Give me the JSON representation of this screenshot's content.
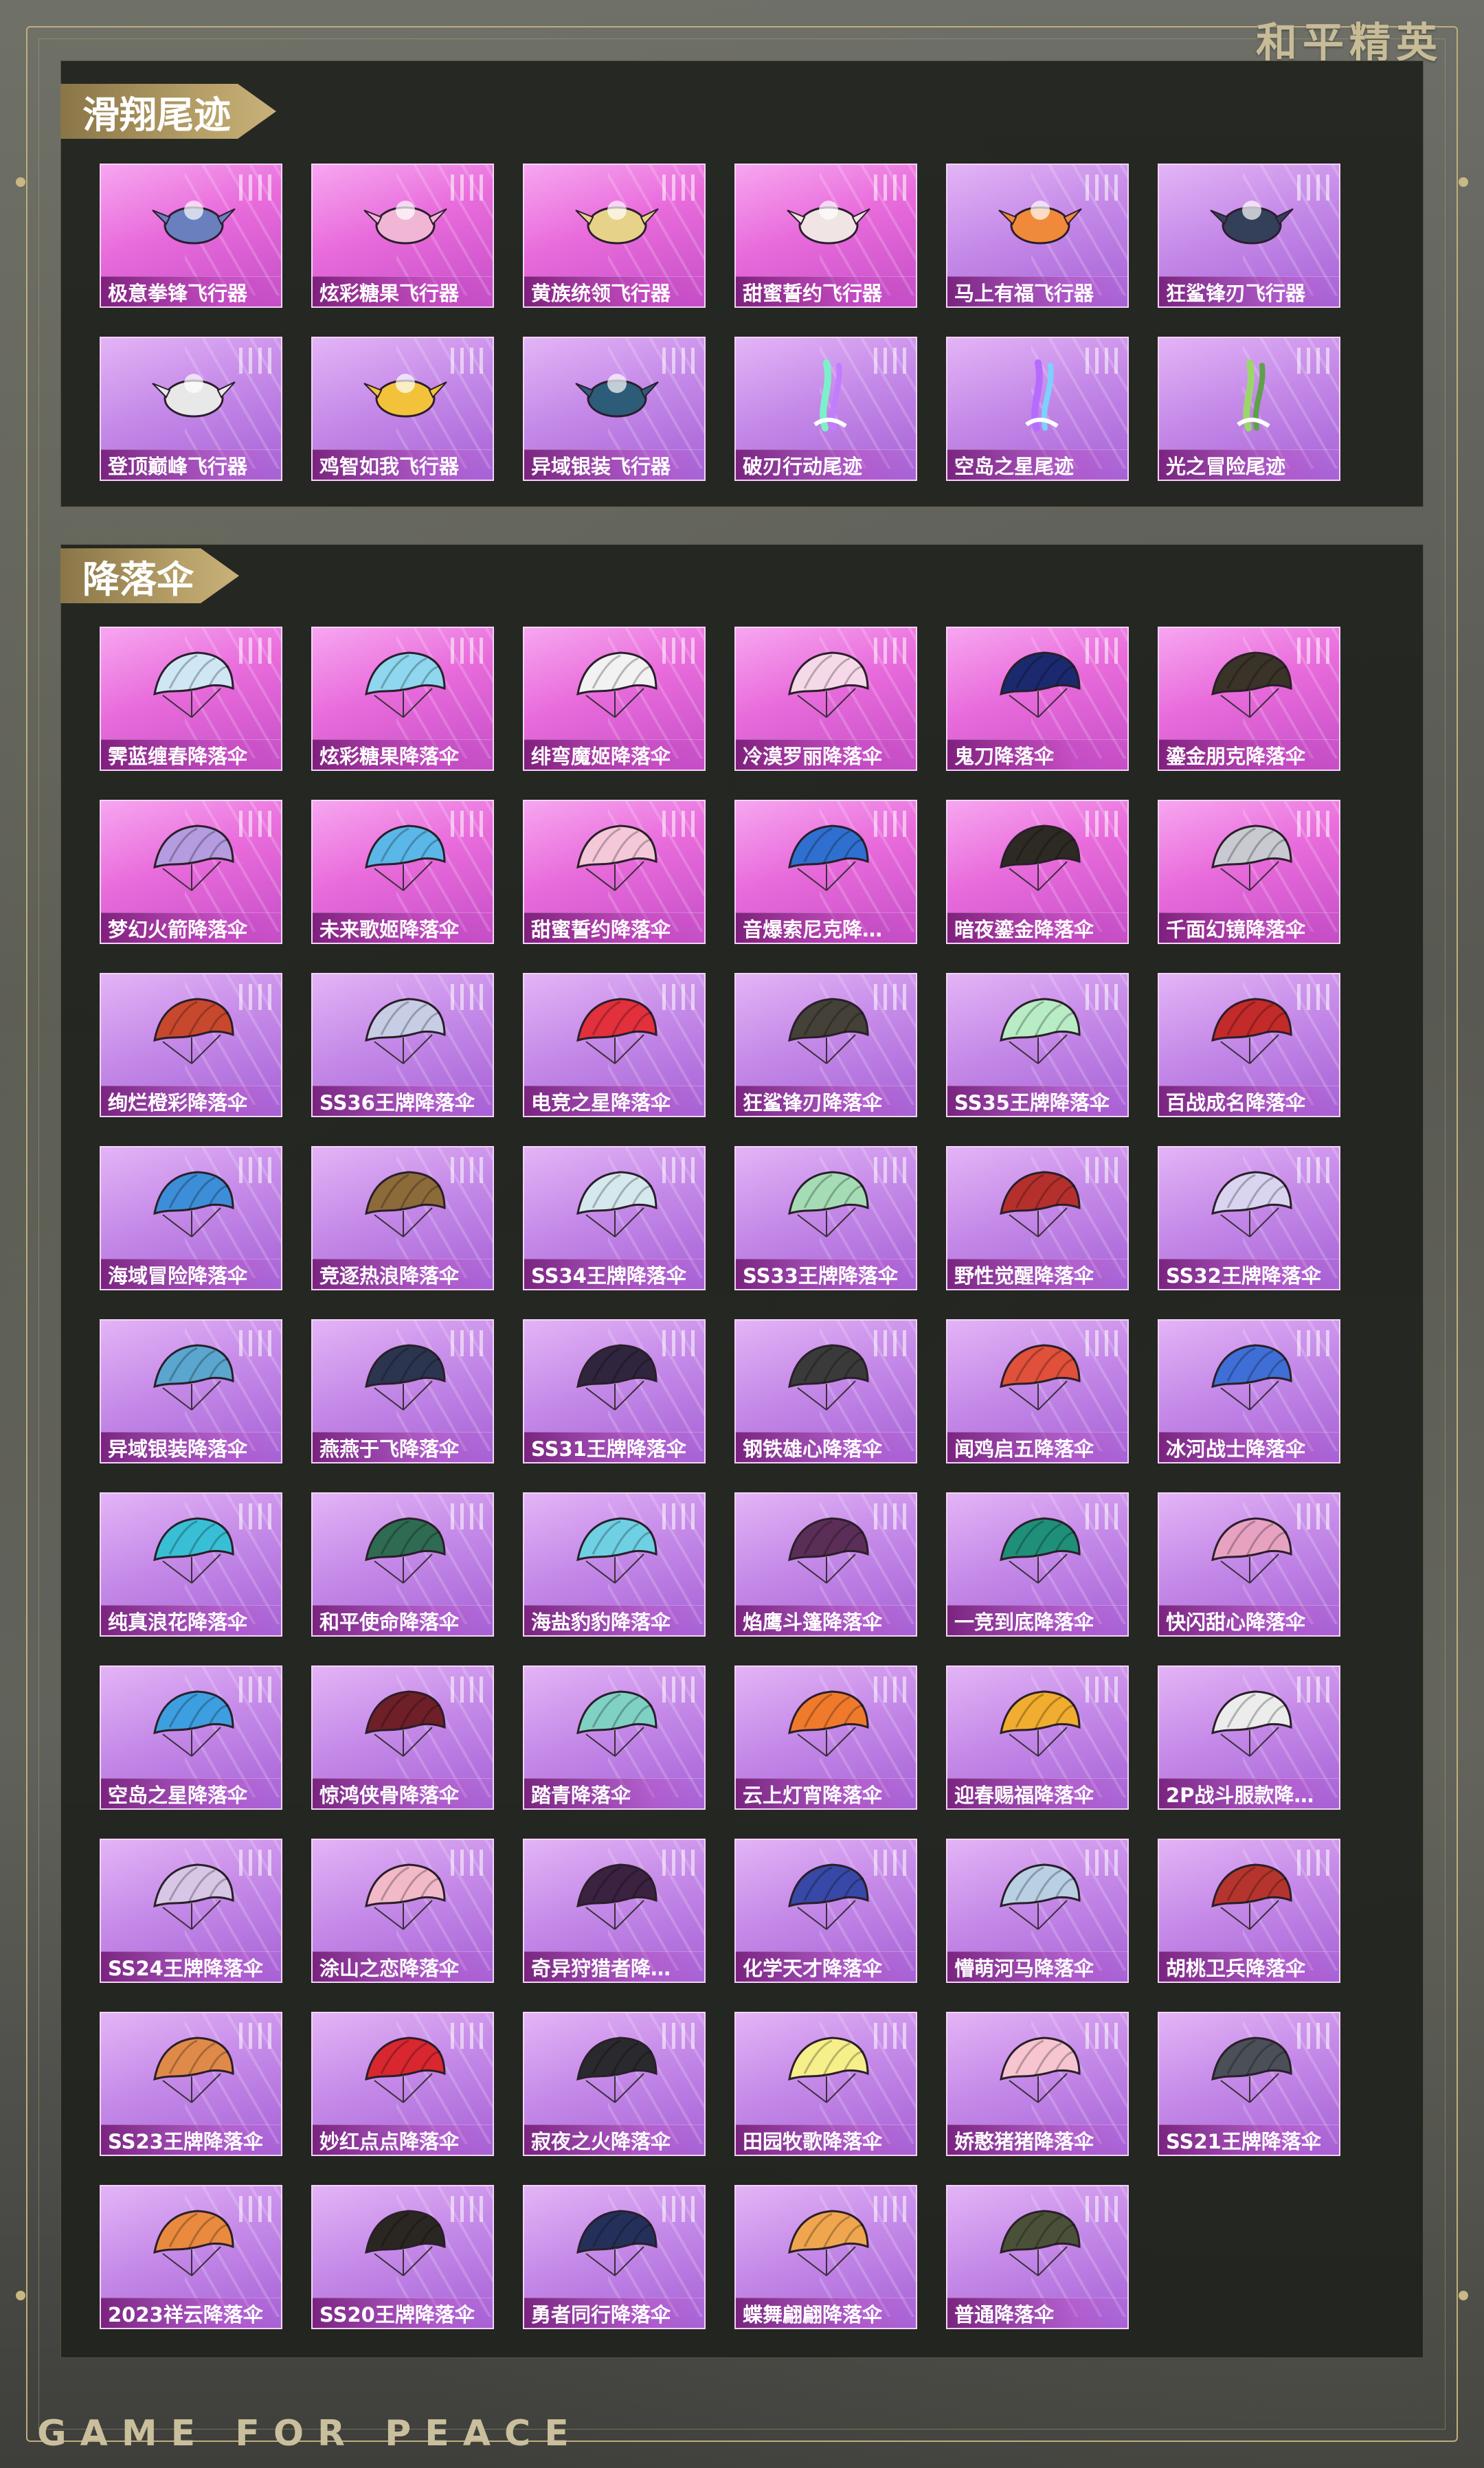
{
  "brand": {
    "logo": "和平精英",
    "footer": "GAME FOR PEACE"
  },
  "sections": [
    {
      "title": "滑翔尾迹",
      "items": [
        {
          "name": "极意拳锋飞行器",
          "type": "glider",
          "bg": "pink"
        },
        {
          "name": "炫彩糖果飞行器",
          "type": "glider",
          "bg": "pink"
        },
        {
          "name": "黄族统领飞行器",
          "type": "glider",
          "bg": "pink"
        },
        {
          "name": "甜蜜誓约飞行器",
          "type": "glider",
          "bg": "pink"
        },
        {
          "name": "马上有福飞行器",
          "type": "glider",
          "bg": "purple"
        },
        {
          "name": "狂鲨锋刃飞行器",
          "type": "glider",
          "bg": "purple"
        },
        {
          "name": "登顶巅峰飞行器",
          "type": "glider",
          "bg": "purple"
        },
        {
          "name": "鸡智如我飞行器",
          "type": "glider",
          "bg": "purple"
        },
        {
          "name": "异域银装飞行器",
          "type": "glider",
          "bg": "purple"
        },
        {
          "name": "破刃行动尾迹",
          "type": "trail",
          "bg": "purple"
        },
        {
          "name": "空岛之星尾迹",
          "type": "trail",
          "bg": "purple"
        },
        {
          "name": "光之冒险尾迹",
          "type": "trail",
          "bg": "purple"
        }
      ]
    },
    {
      "title": "降落伞",
      "items": [
        {
          "name": "霁蓝缠春降落伞",
          "type": "parachute",
          "bg": "pink",
          "color": "#cfe6f5"
        },
        {
          "name": "炫彩糖果降落伞",
          "type": "parachute",
          "bg": "pink",
          "color": "#8fd6ef"
        },
        {
          "name": "绯弯魔姬降落伞",
          "type": "parachute",
          "bg": "pink",
          "color": "#f2f2f2"
        },
        {
          "name": "冷漠罗丽降落伞",
          "type": "parachute",
          "bg": "pink",
          "color": "#f6d9e8"
        },
        {
          "name": "鬼刀降落伞",
          "type": "parachute",
          "bg": "pink",
          "color": "#1b2a6e"
        },
        {
          "name": "鎏金朋克降落伞",
          "type": "parachute",
          "bg": "pink",
          "color": "#3a3328"
        },
        {
          "name": "梦幻火箭降落伞",
          "type": "parachute",
          "bg": "pink",
          "color": "#b59be0"
        },
        {
          "name": "未来歌姬降落伞",
          "type": "parachute",
          "bg": "pink",
          "color": "#5ab7e8"
        },
        {
          "name": "甜蜜誓约降落伞",
          "type": "parachute",
          "bg": "pink",
          "color": "#f4c8d8"
        },
        {
          "name": "音爆索尼克降…",
          "type": "parachute",
          "bg": "pink",
          "color": "#2f6fd0"
        },
        {
          "name": "暗夜鎏金降落伞",
          "type": "parachute",
          "bg": "pink",
          "color": "#2d2a24"
        },
        {
          "name": "千面幻镜降落伞",
          "type": "parachute",
          "bg": "pink",
          "color": "#c9c9d2"
        },
        {
          "name": "绚烂橙彩降落伞",
          "type": "parachute",
          "bg": "purple",
          "color": "#c8482e"
        },
        {
          "name": "SS36王牌降落伞",
          "type": "parachute",
          "bg": "purple",
          "color": "#c7cde4"
        },
        {
          "name": "电竞之星降落伞",
          "type": "parachute",
          "bg": "purple",
          "color": "#e2303c"
        },
        {
          "name": "狂鲨锋刃降落伞",
          "type": "parachute",
          "bg": "purple",
          "color": "#444139"
        },
        {
          "name": "SS35王牌降落伞",
          "type": "parachute",
          "bg": "purple",
          "color": "#b8ecc4"
        },
        {
          "name": "百战成名降落伞",
          "type": "parachute",
          "bg": "purple",
          "color": "#c32a2a"
        },
        {
          "name": "海域冒险降落伞",
          "type": "parachute",
          "bg": "purple",
          "color": "#3d8ed8"
        },
        {
          "name": "竞逐热浪降落伞",
          "type": "parachute",
          "bg": "purple",
          "color": "#8c6a3a"
        },
        {
          "name": "SS34王牌降落伞",
          "type": "parachute",
          "bg": "purple",
          "color": "#d5e8ee"
        },
        {
          "name": "SS33王牌降落伞",
          "type": "parachute",
          "bg": "purple",
          "color": "#a5dcb6"
        },
        {
          "name": "野性觉醒降落伞",
          "type": "parachute",
          "bg": "purple",
          "color": "#b5302d"
        },
        {
          "name": "SS32王牌降落伞",
          "type": "parachute",
          "bg": "purple",
          "color": "#d9d4ef"
        },
        {
          "name": "异域银装降落伞",
          "type": "parachute",
          "bg": "purple",
          "color": "#5aa6cf"
        },
        {
          "name": "燕燕于飞降落伞",
          "type": "parachute",
          "bg": "purple",
          "color": "#2c3550"
        },
        {
          "name": "SS31王牌降落伞",
          "type": "parachute",
          "bg": "purple",
          "color": "#30253e"
        },
        {
          "name": "钢铁雄心降落伞",
          "type": "parachute",
          "bg": "purple",
          "color": "#3b3a3a"
        },
        {
          "name": "闻鸡启五降落伞",
          "type": "parachute",
          "bg": "purple",
          "color": "#e0503a"
        },
        {
          "name": "冰河战士降落伞",
          "type": "parachute",
          "bg": "purple",
          "color": "#3f6fd6"
        },
        {
          "name": "纯真浪花降落伞",
          "type": "parachute",
          "bg": "purple",
          "color": "#38bfd6"
        },
        {
          "name": "和平使命降落伞",
          "type": "parachute",
          "bg": "purple",
          "color": "#2e6b52"
        },
        {
          "name": "海盐豹豹降落伞",
          "type": "parachute",
          "bg": "purple",
          "color": "#6fd0e3"
        },
        {
          "name": "焰鹰斗篷降落伞",
          "type": "parachute",
          "bg": "purple",
          "color": "#5b2e58"
        },
        {
          "name": "一竞到底降落伞",
          "type": "parachute",
          "bg": "purple",
          "color": "#1f8f7a"
        },
        {
          "name": "快闪甜心降落伞",
          "type": "parachute",
          "bg": "purple",
          "color": "#e7a2c2"
        },
        {
          "name": "空岛之星降落伞",
          "type": "parachute",
          "bg": "purple",
          "color": "#3d9fe0"
        },
        {
          "name": "惊鸿侠骨降落伞",
          "type": "parachute",
          "bg": "purple",
          "color": "#6e1f27"
        },
        {
          "name": "踏青降落伞",
          "type": "parachute",
          "bg": "purple",
          "color": "#7fd1c4"
        },
        {
          "name": "云上灯宵降落伞",
          "type": "parachute",
          "bg": "purple",
          "color": "#f07a2c"
        },
        {
          "name": "迎春赐福降落伞",
          "type": "parachute",
          "bg": "purple",
          "color": "#f0ad2f"
        },
        {
          "name": "2P战斗服款降…",
          "type": "parachute",
          "bg": "purple",
          "color": "#ececec"
        },
        {
          "name": "SS24王牌降落伞",
          "type": "parachute",
          "bg": "purple",
          "color": "#d7c6e6"
        },
        {
          "name": "涂山之恋降落伞",
          "type": "parachute",
          "bg": "purple",
          "color": "#f2b9c8"
        },
        {
          "name": "奇异狩猎者降…",
          "type": "parachute",
          "bg": "purple",
          "color": "#3a2240"
        },
        {
          "name": "化学天才降落伞",
          "type": "parachute",
          "bg": "purple",
          "color": "#3848a6"
        },
        {
          "name": "懵萌河马降落伞",
          "type": "parachute",
          "bg": "purple",
          "color": "#b9cfe3"
        },
        {
          "name": "胡桃卫兵降落伞",
          "type": "parachute",
          "bg": "purple",
          "color": "#b5352e"
        },
        {
          "name": "SS23王牌降落伞",
          "type": "parachute",
          "bg": "purple",
          "color": "#e08a4a"
        },
        {
          "name": "妙红点点降落伞",
          "type": "parachute",
          "bg": "purple",
          "color": "#d9272f"
        },
        {
          "name": "寂夜之火降落伞",
          "type": "parachute",
          "bg": "purple",
          "color": "#2a2a2e"
        },
        {
          "name": "田园牧歌降落伞",
          "type": "parachute",
          "bg": "purple",
          "color": "#f7ef8a"
        },
        {
          "name": "娇憨猪猪降落伞",
          "type": "parachute",
          "bg": "purple",
          "color": "#f6c5cf"
        },
        {
          "name": "SS21王牌降落伞",
          "type": "parachute",
          "bg": "purple",
          "color": "#4a4f58"
        },
        {
          "name": "2023祥云降落伞",
          "type": "parachute",
          "bg": "purple",
          "color": "#e98a3f"
        },
        {
          "name": "SS20王牌降落伞",
          "type": "parachute",
          "bg": "purple",
          "color": "#2a2622"
        },
        {
          "name": "勇者同行降落伞",
          "type": "parachute",
          "bg": "purple",
          "color": "#25305a"
        },
        {
          "name": "蝶舞翩翩降落伞",
          "type": "parachute",
          "bg": "purple",
          "color": "#f0a64e"
        },
        {
          "name": "普通降落伞",
          "type": "parachute",
          "bg": "purple",
          "color": "#4b5138"
        }
      ]
    }
  ]
}
